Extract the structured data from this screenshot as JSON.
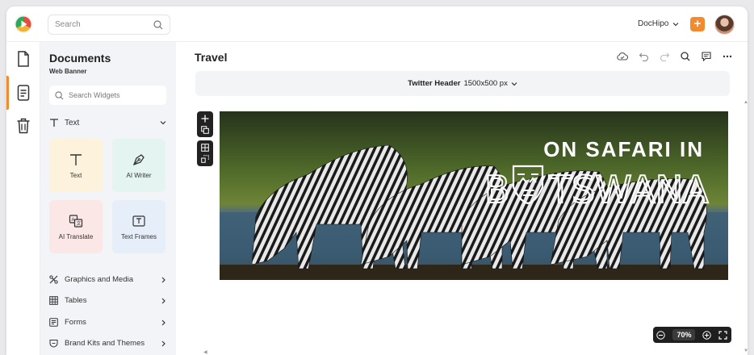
{
  "topbar": {
    "search_placeholder": "Search",
    "brand_name": "DocHipo",
    "plus_label": "+"
  },
  "rail": {
    "items": [
      "document-icon",
      "page-icon",
      "trash-icon"
    ],
    "active_index": 1
  },
  "panel": {
    "title": "Documents",
    "subtitle": "Web Banner",
    "widget_search_placeholder": "Search Widgets",
    "section_label": "Text",
    "tiles": [
      {
        "label": "Text",
        "icon": "text-t-icon",
        "bg": "#fdf3dc"
      },
      {
        "label": "AI Writer",
        "icon": "pen-nib-icon",
        "bg": "#e4f4f1"
      },
      {
        "label": "AI Translate",
        "icon": "translate-icon",
        "bg": "#fce7e7"
      },
      {
        "label": "Text Frames",
        "icon": "text-frame-icon",
        "bg": "#e6eef9"
      }
    ],
    "menu": [
      {
        "label": "Graphics and Media",
        "icon": "graphics-icon"
      },
      {
        "label": "Tables",
        "icon": "table-icon"
      },
      {
        "label": "Forms",
        "icon": "form-icon"
      },
      {
        "label": "Brand Kits and Themes",
        "icon": "brand-kit-icon"
      }
    ]
  },
  "work": {
    "doc_title": "Travel",
    "size_name": "Twitter Header",
    "size_dims": "1500x500 px",
    "zoom_value": "70%"
  },
  "banner": {
    "line1": "ON SAFARI IN",
    "line2_prefix": "B",
    "line2_suffix": "TSWANA"
  },
  "colors": {
    "accent": "#f28b30",
    "panel_bg": "#f3f4f7"
  }
}
